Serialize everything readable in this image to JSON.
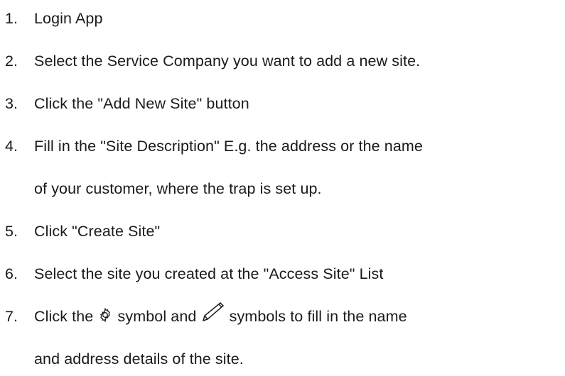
{
  "steps": [
    {
      "number": "1.",
      "lines": [
        "Login App"
      ]
    },
    {
      "number": "2.",
      "lines": [
        "Select the Service Company you want to add a new site."
      ]
    },
    {
      "number": "3.",
      "lines": [
        "Click the \"Add New Site\" button"
      ]
    },
    {
      "number": "4.",
      "lines": [
        "Fill in the \"Site Description\" E.g. the address or the name",
        "of your customer, where the trap is set up."
      ]
    },
    {
      "number": "5.",
      "lines": [
        "Click \"Create Site\""
      ]
    },
    {
      "number": "6.",
      "lines": [
        "Select the site you created at the \"Access Site\" List"
      ]
    },
    {
      "number": "7.",
      "line1_a": "Click the",
      "gear_icon": "gear-icon",
      "line1_b": "symbol and",
      "pencil_icon": "pencil-icon",
      "line1_c": "symbols to fill in the name",
      "line2": "and address details of the site."
    }
  ]
}
